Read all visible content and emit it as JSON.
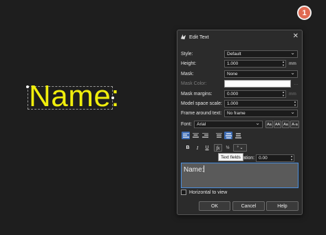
{
  "badge": "1",
  "canvas": {
    "text": "Name:",
    "text_color": "#f0ee0c"
  },
  "dialog": {
    "title": "Edit Text",
    "fields": {
      "style": {
        "label": "Style:",
        "value": "Default"
      },
      "height": {
        "label": "Height:",
        "value": "1.000",
        "unit": "mm"
      },
      "mask": {
        "label": "Mask:",
        "value": "None"
      },
      "mask_color": {
        "label": "Mask Color:"
      },
      "mask_margins": {
        "label": "Mask margins:",
        "value": "0.000",
        "unit": "mm"
      },
      "model_space_scale": {
        "label": "Model space scale:",
        "value": "1.000"
      },
      "frame": {
        "label": "Frame around text:",
        "value": "No frame"
      },
      "font": {
        "label": "Font:",
        "value": "Arial"
      }
    },
    "case_buttons": [
      "Aa",
      "AA",
      "Aa",
      "A-a"
    ],
    "format_buttons": {
      "bold": "B",
      "italic": "I",
      "underline": "U",
      "fields": "fx"
    },
    "rotation": {
      "label": "ation:",
      "value": "0.00"
    },
    "tooltip": "Text fields",
    "text_value": "Name:",
    "horizontal_label": "Horizontal to view",
    "buttons": {
      "ok": "OK",
      "cancel": "Cancel",
      "help": "Help"
    }
  },
  "colors": {
    "accent": "#3c6bb4",
    "badge": "#e06a52",
    "focus": "#4a8fe0"
  }
}
